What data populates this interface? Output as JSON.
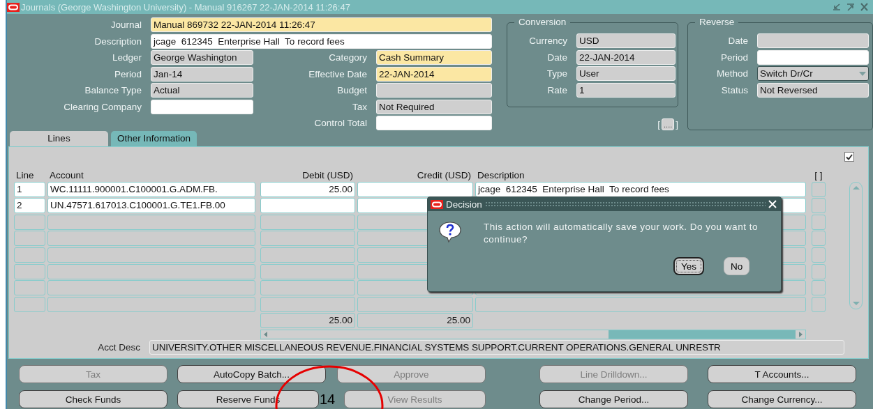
{
  "window": {
    "title": "Journals (George Washington University) - Manual 916267 22-JAN-2014 11:26:47"
  },
  "header": {
    "top_fields": [
      {
        "label": "Journal",
        "value": "Manual 869732 22-JAN-2014 11:26:47",
        "kind": "required"
      },
      {
        "label": "Description",
        "value": "jcage  612345  Enterprise Hall  To record fees",
        "kind": "editable"
      }
    ],
    "left_fields": [
      {
        "label": "Ledger",
        "value": "George Washington",
        "kind": "readonly"
      },
      {
        "label": "Period",
        "value": "Jan-14",
        "kind": "readonly"
      },
      {
        "label": "Balance Type",
        "value": "Actual",
        "kind": "readonly"
      },
      {
        "label": "Clearing Company",
        "kind": "editable"
      }
    ],
    "right_fields": [
      {
        "label": "Category",
        "value": "Cash Summary",
        "kind": "required"
      },
      {
        "label": "Effective Date",
        "value": "22-JAN-2014",
        "kind": "required"
      },
      {
        "label": "Budget",
        "kind": "readonly"
      },
      {
        "label": "Tax",
        "value": "Not Required",
        "kind": "readonly"
      },
      {
        "label": "Control Total",
        "kind": "editable"
      }
    ]
  },
  "conversion": {
    "title": "Conversion",
    "fields": [
      {
        "label": "Currency",
        "value": "USD",
        "kind": "readonly"
      },
      {
        "label": "Date",
        "value": "22-JAN-2014",
        "kind": "readonly"
      },
      {
        "label": "Type",
        "value": "User",
        "kind": "readonly"
      },
      {
        "label": "Rate",
        "value": "1",
        "kind": "readonly"
      }
    ]
  },
  "more_field": {
    "open": "[",
    "label": "....",
    "close": "]"
  },
  "reverse": {
    "title": "Reverse",
    "fields": [
      {
        "label": "Date",
        "kind": "readonly"
      },
      {
        "label": "Period",
        "kind": "editable"
      },
      {
        "label": "Method",
        "value": "Switch Dr/Cr",
        "kind": "dropdown"
      },
      {
        "label": "Status",
        "value": "Not Reversed",
        "kind": "readonly"
      }
    ]
  },
  "tabs": [
    {
      "label": "Lines",
      "selected": true
    },
    {
      "label": "Other Information",
      "selected": false
    }
  ],
  "lines": {
    "checkbox": {
      "checked": true
    },
    "columns": [
      "Line",
      "Account",
      "Debit (USD)",
      "Credit (USD)",
      "Description",
      "[ ]"
    ],
    "rows": [
      {
        "line": "1",
        "account": "WC.11111.900001.C100001.G.ADM.FB.",
        "debit": "25.00",
        "description": "jcage  612345  Enterprise Hall  To record fees"
      },
      {
        "line": "2",
        "account": "UN.47571.617013.C100001.G.TE1.FB.00"
      }
    ],
    "totals": {
      "debit": "25.00",
      "credit": "25.00"
    },
    "acct_desc": {
      "label": "Acct Desc",
      "value": "UNIVERSITY.OTHER MISCELLANEOUS REVENUE.FINANCIAL SYSTEMS SUPPORT.CURRENT OPERATIONS.GENERAL UNRESTR"
    }
  },
  "dialog": {
    "title": "Decision",
    "message": "This action will automatically save your work. Do you want to continue?",
    "buttons": [
      {
        "label": "Yes",
        "selected": true
      },
      {
        "label": "No",
        "selected": false
      }
    ]
  },
  "action_buttons": [
    {
      "label": "Tax",
      "disabled": true
    },
    {
      "label": "AutoCopy Batch...",
      "disabled": false
    },
    {
      "label": "Approve",
      "disabled": true
    },
    {
      "label": "Line Drilldown...",
      "disabled": true
    },
    {
      "label": "T Accounts...",
      "disabled": false
    },
    {
      "label": "Check Funds",
      "disabled": false
    },
    {
      "label": "Reserve Funds",
      "disabled": false
    },
    {
      "label": "View Results",
      "disabled": true
    },
    {
      "label": "Change Period...",
      "disabled": false
    },
    {
      "label": "Change Currency...",
      "disabled": false
    }
  ],
  "annotation": {
    "label": "14"
  }
}
